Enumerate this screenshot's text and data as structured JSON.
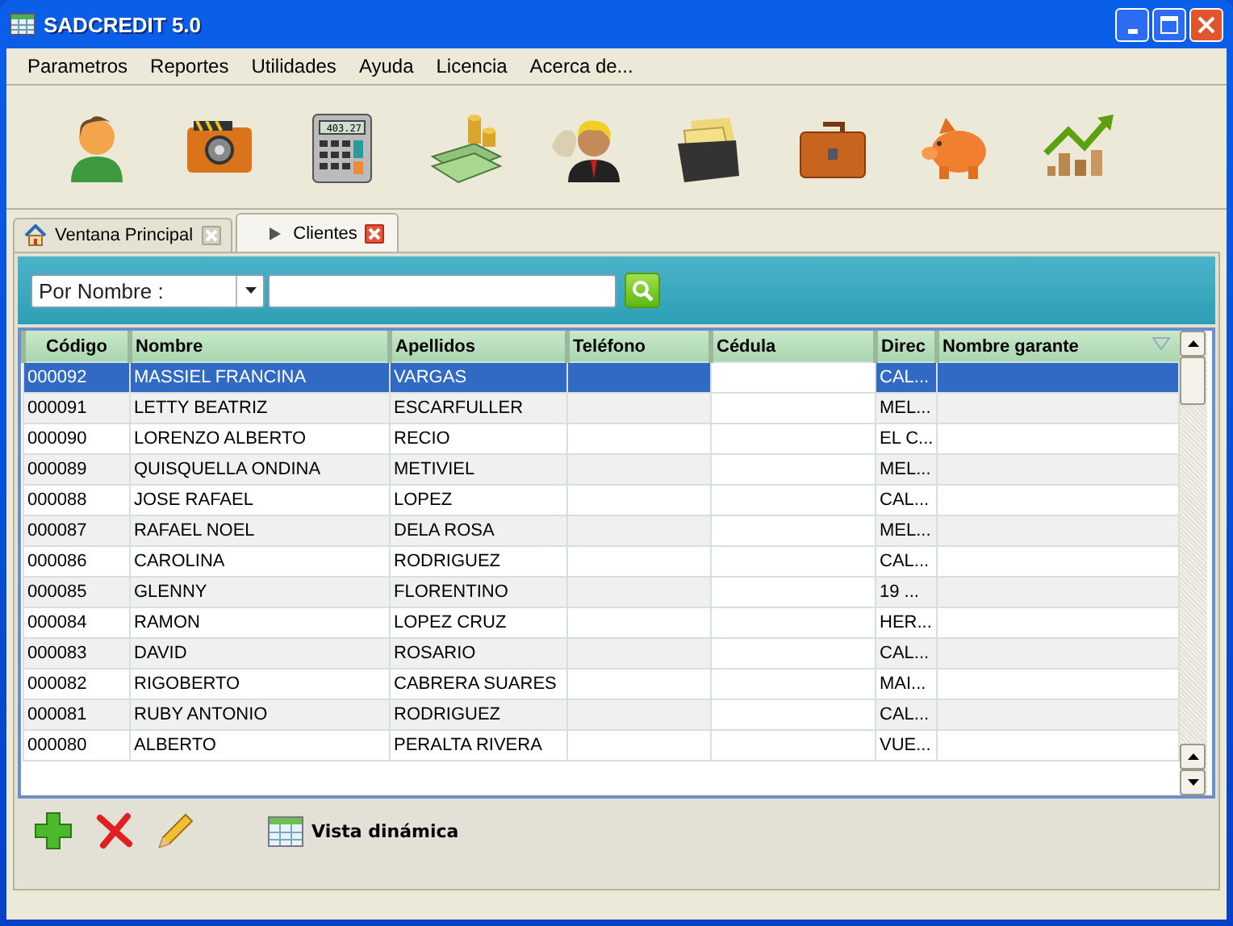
{
  "window": {
    "title": "SADCREDIT 5.0"
  },
  "menu": [
    "Parametros",
    "Reportes",
    "Utilidades",
    "Ayuda",
    "Licencia",
    "Acerca de..."
  ],
  "toolbar": [
    {
      "kind": "person"
    },
    {
      "kind": "safe"
    },
    {
      "kind": "calculator",
      "display": "403.27"
    },
    {
      "kind": "money"
    },
    {
      "kind": "businessman"
    },
    {
      "kind": "files"
    },
    {
      "kind": "briefcase"
    },
    {
      "kind": "piggy"
    },
    {
      "kind": "growth"
    }
  ],
  "tabs": [
    {
      "label": "Ventana Principal",
      "kind": "home",
      "selected": false
    },
    {
      "label": "Clientes",
      "kind": "arrow",
      "selected": true
    }
  ],
  "search": {
    "mode": "Por Nombre :"
  },
  "table": {
    "columns": [
      "Código",
      "Nombre",
      "Apellidos",
      "Teléfono",
      "Cédula",
      "Direc",
      "Nombre garante"
    ],
    "rows": [
      {
        "cells": [
          "000092",
          "MASSIEL FRANCINA",
          "VARGAS",
          "",
          "",
          "CAL...",
          ""
        ],
        "selected": true
      },
      {
        "cells": [
          "000091",
          "LETTY BEATRIZ",
          "ESCARFULLER",
          "",
          "",
          "MEL...",
          ""
        ],
        "selected": false
      },
      {
        "cells": [
          "000090",
          "LORENZO ALBERTO",
          "RECIO",
          "",
          "",
          "EL C...",
          ""
        ],
        "selected": false
      },
      {
        "cells": [
          "000089",
          "QUISQUELLA ONDINA",
          "METIVIEL",
          "",
          "",
          "MEL...",
          ""
        ],
        "selected": false
      },
      {
        "cells": [
          "000088",
          "JOSE RAFAEL",
          "LOPEZ",
          "",
          "",
          "CAL...",
          ""
        ],
        "selected": false
      },
      {
        "cells": [
          "000087",
          "RAFAEL NOEL",
          "DELA ROSA",
          "",
          "",
          "MEL...",
          ""
        ],
        "selected": false
      },
      {
        "cells": [
          "000086",
          "CAROLINA",
          "RODRIGUEZ",
          "",
          "",
          "CAL...",
          ""
        ],
        "selected": false
      },
      {
        "cells": [
          "000085",
          "GLENNY",
          "FLORENTINO",
          "",
          "",
          "19 ...",
          ""
        ],
        "selected": false
      },
      {
        "cells": [
          "000084",
          "RAMON",
          "LOPEZ CRUZ",
          "",
          "",
          "HER...",
          ""
        ],
        "selected": false
      },
      {
        "cells": [
          "000083",
          "DAVID",
          "ROSARIO",
          "",
          "",
          "CAL...",
          ""
        ],
        "selected": false
      },
      {
        "cells": [
          "000082",
          "RIGOBERTO",
          "CABRERA SUARES",
          "",
          "",
          "MAI...",
          ""
        ],
        "selected": false
      },
      {
        "cells": [
          "000081",
          "RUBY ANTONIO",
          "RODRIGUEZ",
          "",
          "",
          "CAL...",
          ""
        ],
        "selected": false
      },
      {
        "cells": [
          "000080",
          "ALBERTO",
          "PERALTA RIVERA",
          "",
          "",
          "VUE...",
          ""
        ],
        "selected": false
      }
    ]
  },
  "actions": [
    {
      "kind": "add"
    },
    {
      "kind": "delete"
    },
    {
      "kind": "edit"
    },
    {
      "kind": "grid",
      "label": "Vista dinámica"
    }
  ]
}
